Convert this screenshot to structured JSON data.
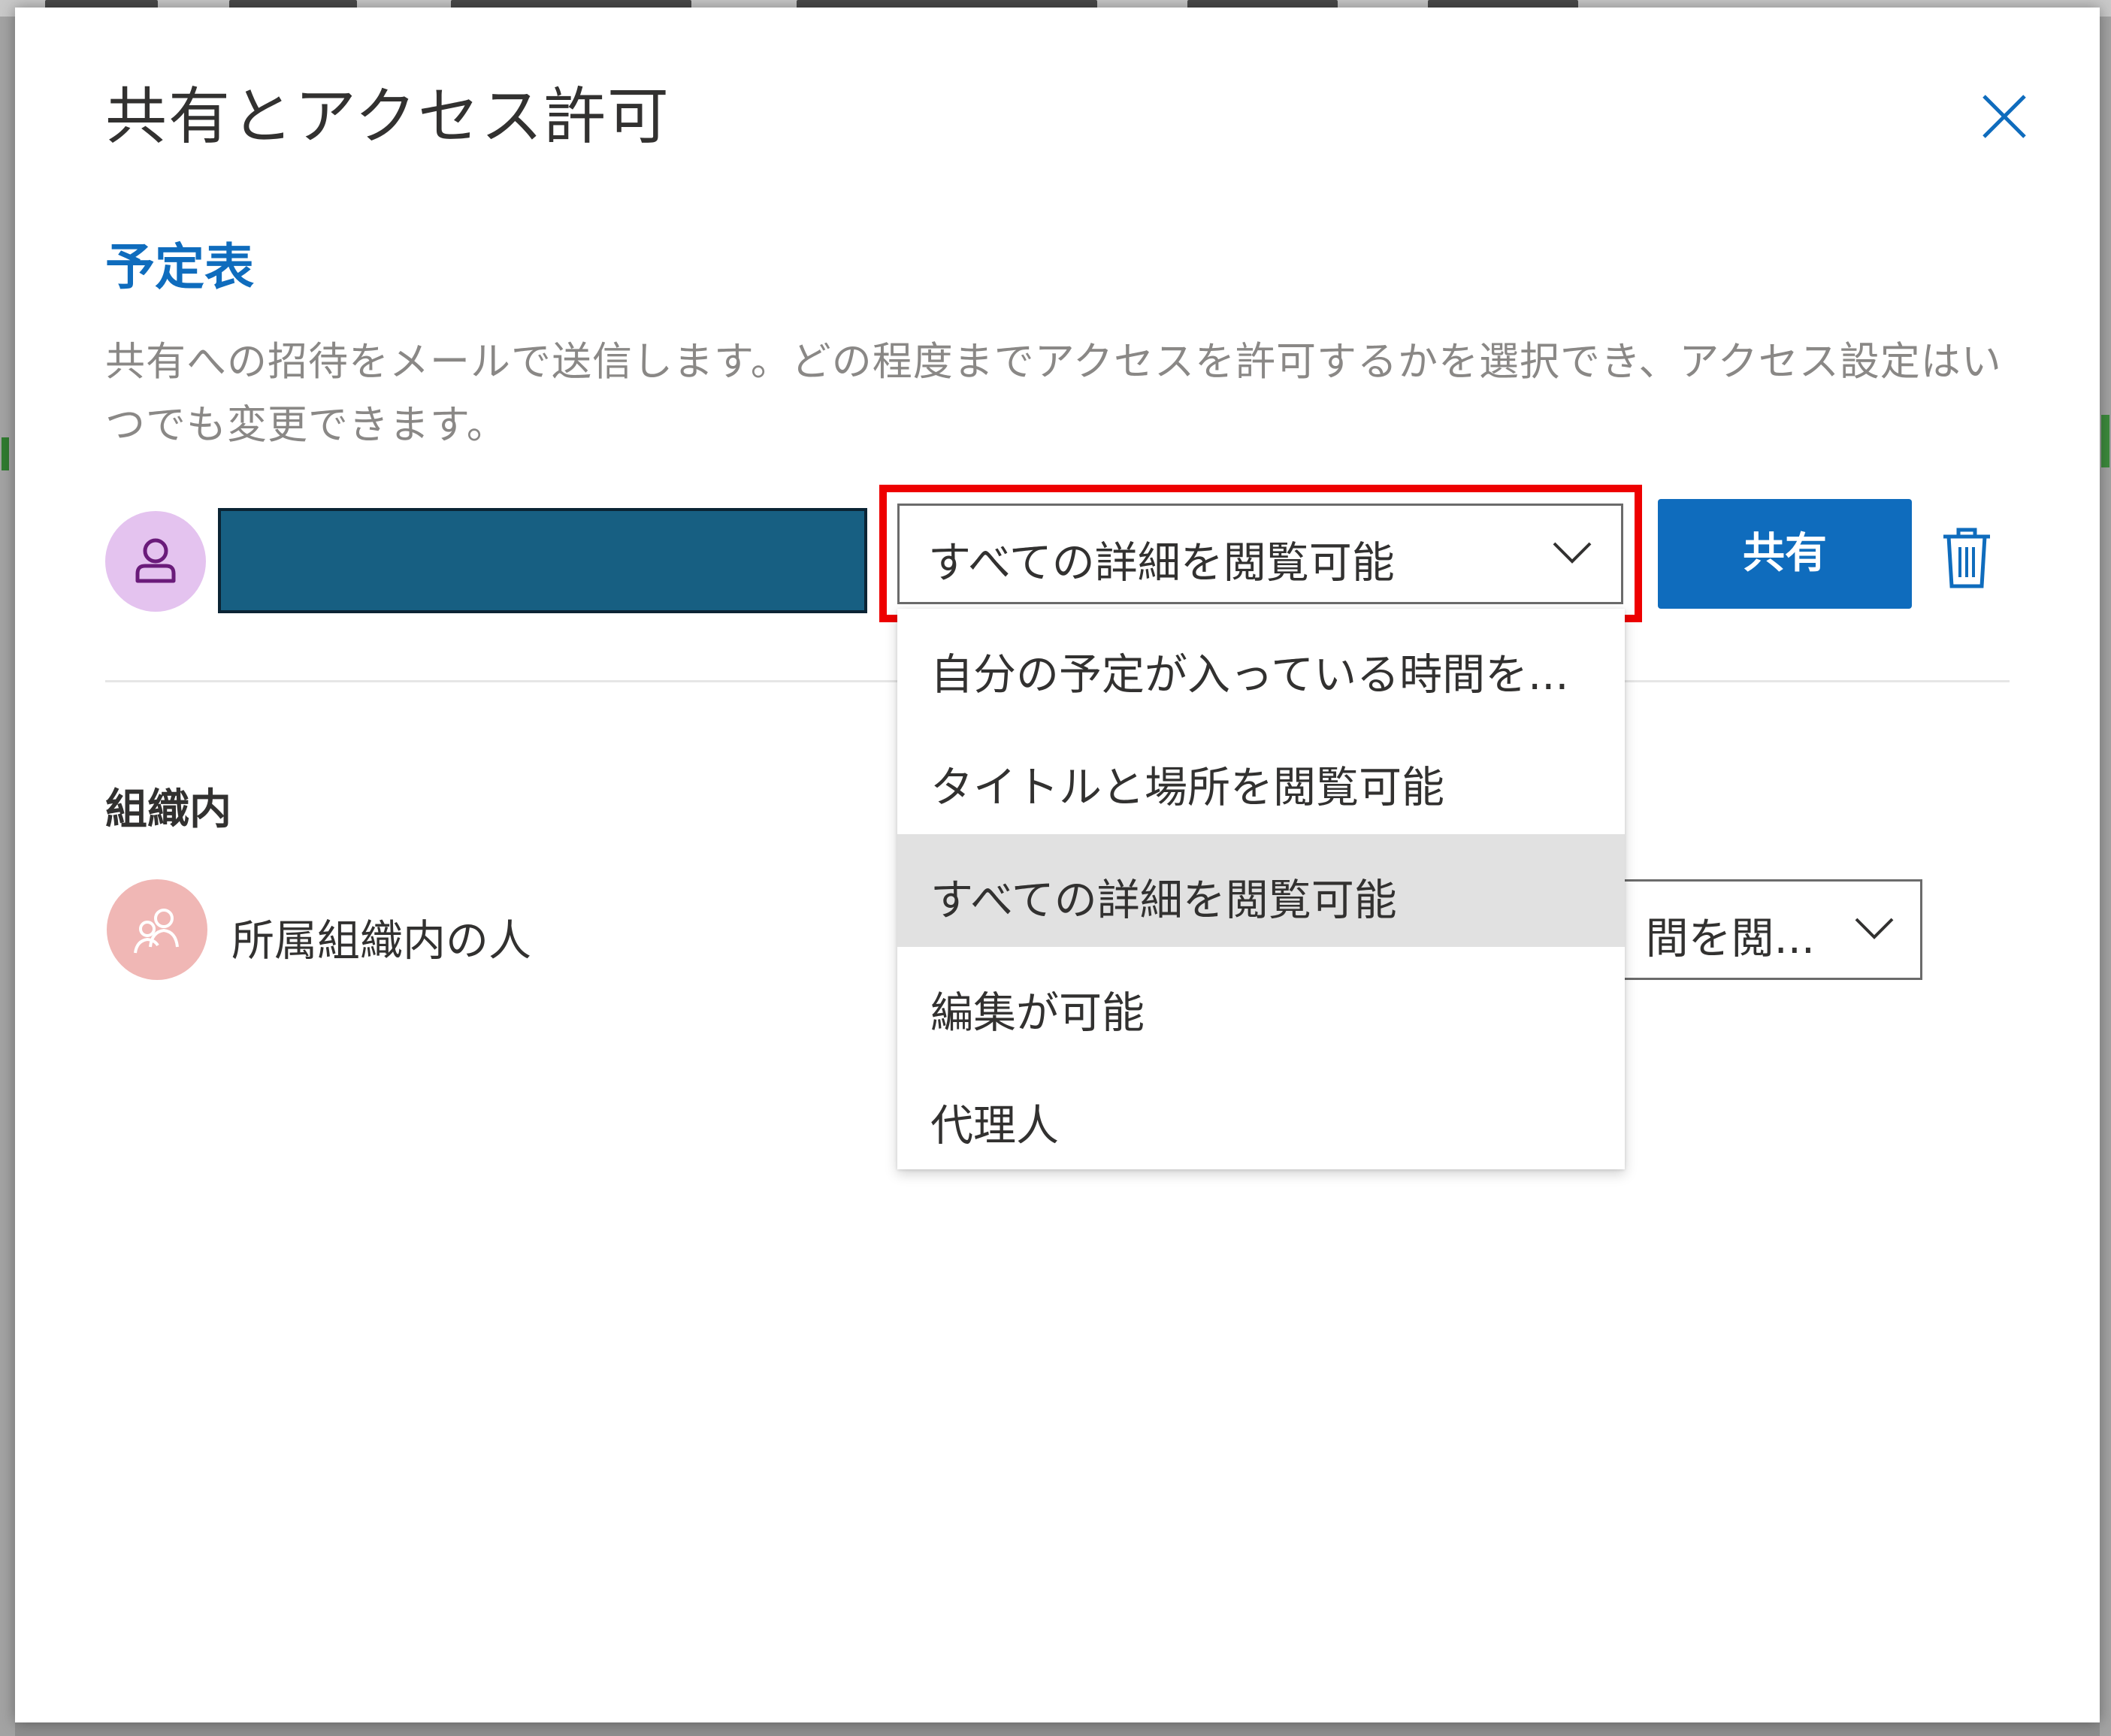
{
  "dialog": {
    "title": "共有とアクセス許可",
    "calendar_name": "予定表",
    "description": "共有への招待をメールで送信します。どの程度までアクセスを許可するかを選択でき、アクセス設定はいつでも変更できます。"
  },
  "share_row": {
    "permission_selected": "すべての詳細を閲覧可能",
    "share_button_label": "共有"
  },
  "permission_options": [
    "自分の予定が入っている時間を...",
    "タイトルと場所を閲覧可能",
    "すべての詳細を閲覧可能",
    "編集が可能",
    "代理人"
  ],
  "selected_option_index": 2,
  "organization": {
    "heading": "組織内",
    "label": "所属組織内の人",
    "permission_value": "間を閲..."
  },
  "icons": {
    "close": "close-icon",
    "delete": "trash-icon",
    "dropdown": "chevron-down-icon",
    "user_avatar": "person-icon",
    "org_avatar": "people-icon"
  },
  "colors": {
    "accent": "#0f6cbd",
    "highlight": "#ee0000",
    "redacted_field": "#175f82",
    "user_avatar_bg": "#e4c3ef",
    "org_avatar_bg": "#f0b7b5",
    "selected_option_bg": "#e1e1e1"
  }
}
